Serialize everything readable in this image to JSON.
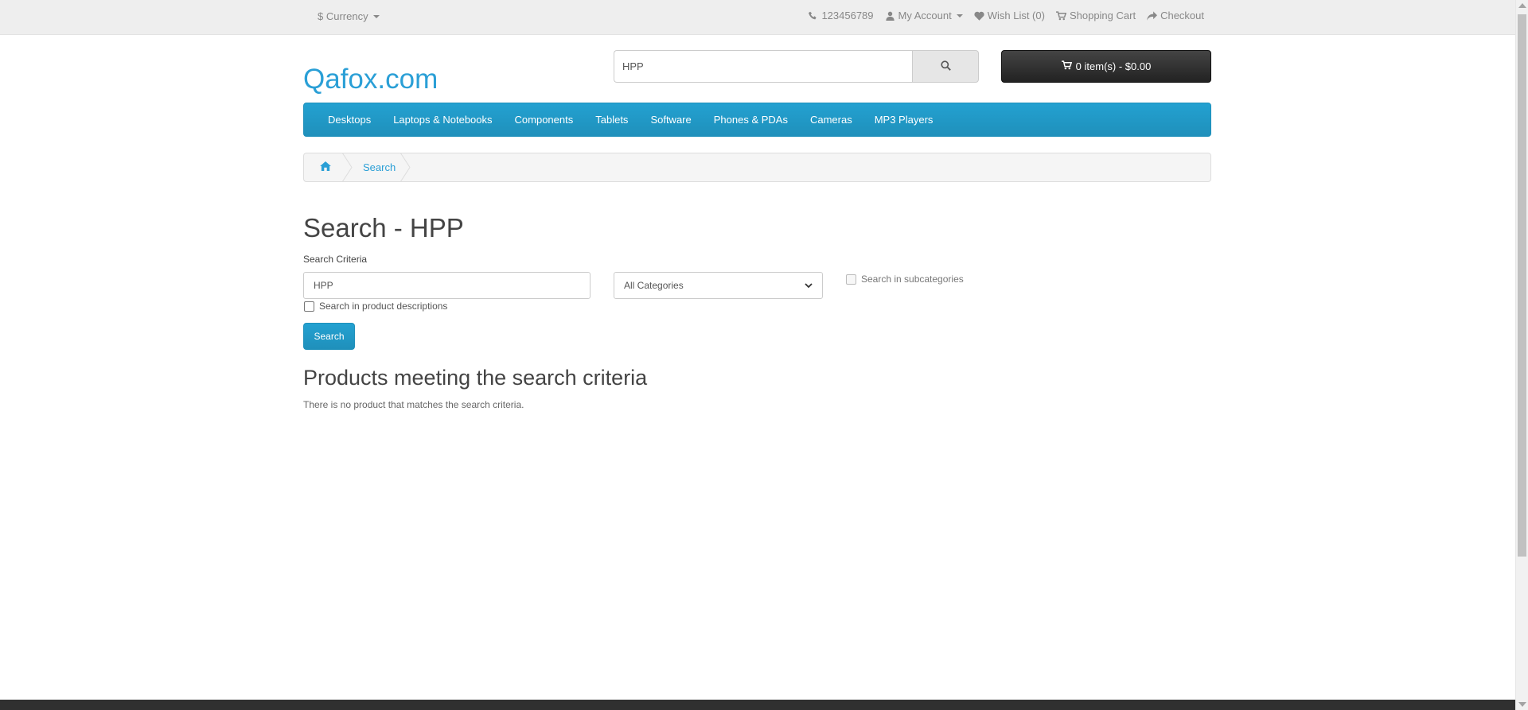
{
  "topbar": {
    "currency_label": "$ Currency",
    "phone": "123456789",
    "my_account": "My Account",
    "wish_list": "Wish List (0)",
    "shopping_cart": "Shopping Cart",
    "checkout": "Checkout"
  },
  "header": {
    "logo": "Qafox.com",
    "search_value": "HPP",
    "cart_label": "0 item(s) - $0.00"
  },
  "menu": {
    "items": [
      "Desktops",
      "Laptops & Notebooks",
      "Components",
      "Tablets",
      "Software",
      "Phones & PDAs",
      "Cameras",
      "MP3 Players"
    ]
  },
  "breadcrumb": {
    "current": "Search"
  },
  "content": {
    "title": "Search - HPP",
    "criteria_label": "Search Criteria",
    "criteria_value": "HPP",
    "category_selected": "All Categories",
    "subcategories_label": "Search in subcategories",
    "descriptions_label": "Search in product descriptions",
    "search_button": "Search",
    "results_title": "Products meeting the search criteria",
    "no_results": "There is no product that matches the search criteria."
  },
  "colors": {
    "accent": "#2a9fd6",
    "menu_bg": "#229ac8",
    "cart_bg": "#303030"
  }
}
